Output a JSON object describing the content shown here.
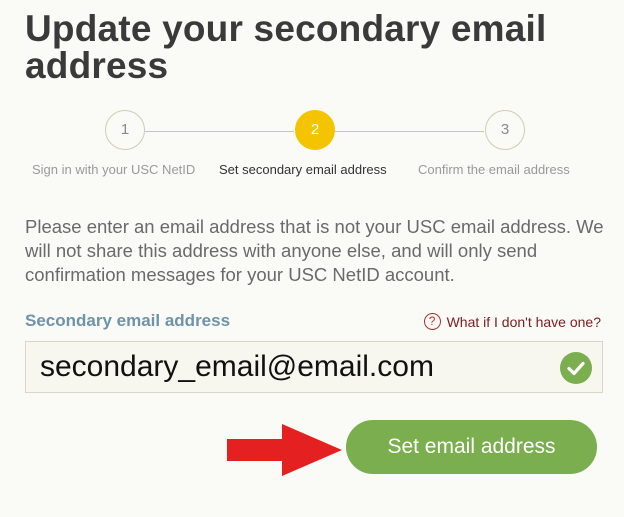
{
  "page": {
    "title": "Update your secondary email address"
  },
  "stepper": {
    "steps": [
      {
        "number": "1",
        "label": "Sign in with your USC NetID"
      },
      {
        "number": "2",
        "label": "Set secondary email address"
      },
      {
        "number": "3",
        "label": "Confirm the email address"
      }
    ],
    "active_step": 2,
    "colors": {
      "active": "#f5c400",
      "inactive_border": "#cfcdb0",
      "line": "#c9c7a6"
    }
  },
  "intro": {
    "text": "Please enter an email address that is not your USC email address. We will not share this address with anyone else, and will only send confirmation messages for your USC NetID account."
  },
  "form": {
    "label": "Secondary email address",
    "help_link": "What if I don't have one?",
    "help_icon": "question-circle-icon",
    "email_value": "secondary_email@email.com",
    "valid_icon": "check-circle-icon",
    "submit_label": "Set email address"
  },
  "annotation": {
    "arrow_icon": "red-arrow-right-icon",
    "arrow_color": "#e52020"
  },
  "colors": {
    "accent_green": "#7aae4f",
    "label_blue": "#6f93a8",
    "link_red": "#7a2020"
  }
}
